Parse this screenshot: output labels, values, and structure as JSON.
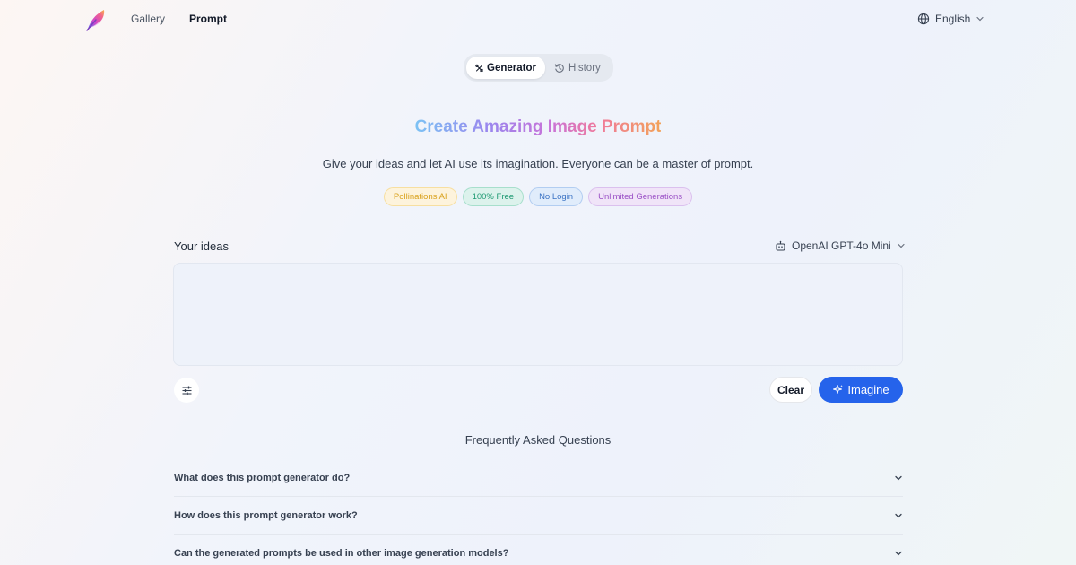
{
  "nav": {
    "links": [
      "Gallery",
      "Prompt"
    ],
    "language": "English"
  },
  "tabs": {
    "generator": "Generator",
    "history": "History"
  },
  "hero": {
    "title": "Create Amazing Image Prompt",
    "subtitle": "Give your ideas and let AI use its imagination. Everyone can be a master of prompt.",
    "badges": [
      "Pollinations AI",
      "100% Free",
      "No Login",
      "Unlimited Generations"
    ]
  },
  "form": {
    "ideas_label": "Your ideas",
    "model": "OpenAI GPT-4o Mini",
    "ideas_value": "",
    "ideas_placeholder": "",
    "clear_label": "Clear",
    "imagine_label": "Imagine"
  },
  "faq": {
    "title": "Frequently Asked Questions",
    "items": [
      "What does this prompt generator do?",
      "How does this prompt generator work?",
      "Can the generated prompts be used in other image generation models?"
    ]
  },
  "colors": {
    "accent": "#2563eb",
    "title_gradient": [
      "#7cc2f4",
      "#9a86ee",
      "#c973d8",
      "#f07a9a",
      "#f2a25a"
    ]
  },
  "icons": [
    "logo-feather-icon",
    "globe-icon",
    "chevron-down-icon",
    "tools-icon",
    "history-icon",
    "robot-icon",
    "sliders-icon",
    "sparkle-icon"
  ]
}
